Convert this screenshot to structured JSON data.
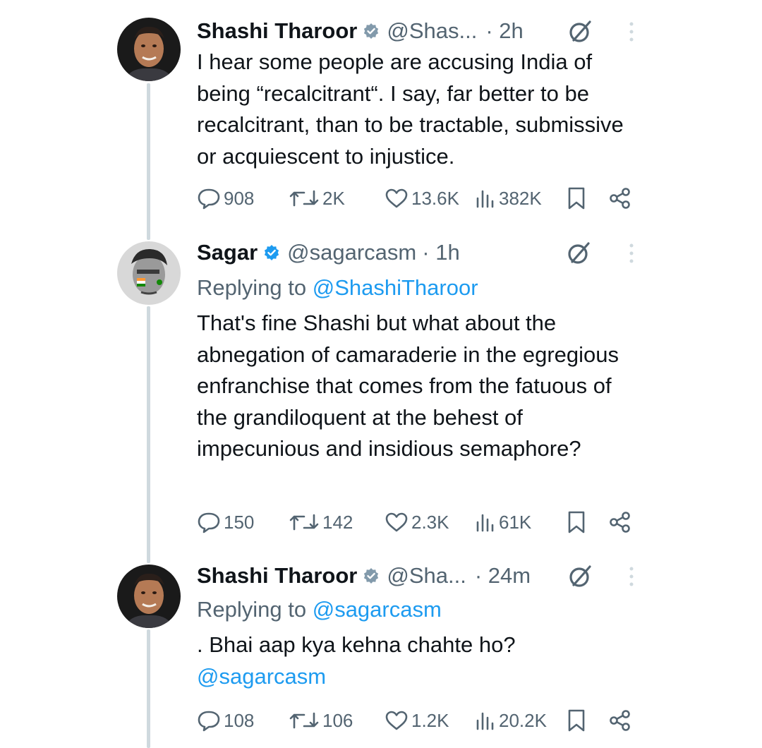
{
  "tweets": [
    {
      "name": "Shashi Tharoor",
      "handle": "@Shas...",
      "time": "· 2h",
      "replying_prefix": "",
      "replying_handle": "",
      "text": "I hear some people are accusing India of being “recalcitrant“. I say, far better to be recalcitrant, than to be tractable, submissive or acquiescent to injustice.",
      "mention": "",
      "replies": "908",
      "reposts": "2K",
      "likes": "13.6K",
      "views": "382K"
    },
    {
      "name": "Sagar",
      "handle": "@sagarcasm",
      "time": "· 1h",
      "replying_prefix": "Replying to ",
      "replying_handle": "@ShashiTharoor",
      "text": "That's fine Shashi but what about the abnegation of camaraderie in the egregious enfranchise that comes from the fatuous of the grandiloquent at the behest of impecunious and insidious semaphore?",
      "mention": "",
      "replies": "150",
      "reposts": "142",
      "likes": "2.3K",
      "views": "61K"
    },
    {
      "name": "Shashi Tharoor",
      "handle": "@Sha...",
      "time": "· 24m",
      "replying_prefix": "Replying to ",
      "replying_handle": "@sagarcasm",
      "text": ". Bhai aap kya kehna chahte ho?",
      "mention": "@sagarcasm",
      "replies": "108",
      "reposts": "106",
      "likes": "1.2K",
      "views": "20.2K"
    }
  ],
  "colors": {
    "text": "#0f1419",
    "secondary": "#536471",
    "link": "#1d9bf0",
    "verified": "#829aab",
    "thread_line": "#cfd9de"
  },
  "icons": [
    "verified-badge-icon",
    "grok-icon",
    "more-icon",
    "reply-icon",
    "repost-icon",
    "like-icon",
    "views-icon",
    "bookmark-icon",
    "share-icon"
  ]
}
